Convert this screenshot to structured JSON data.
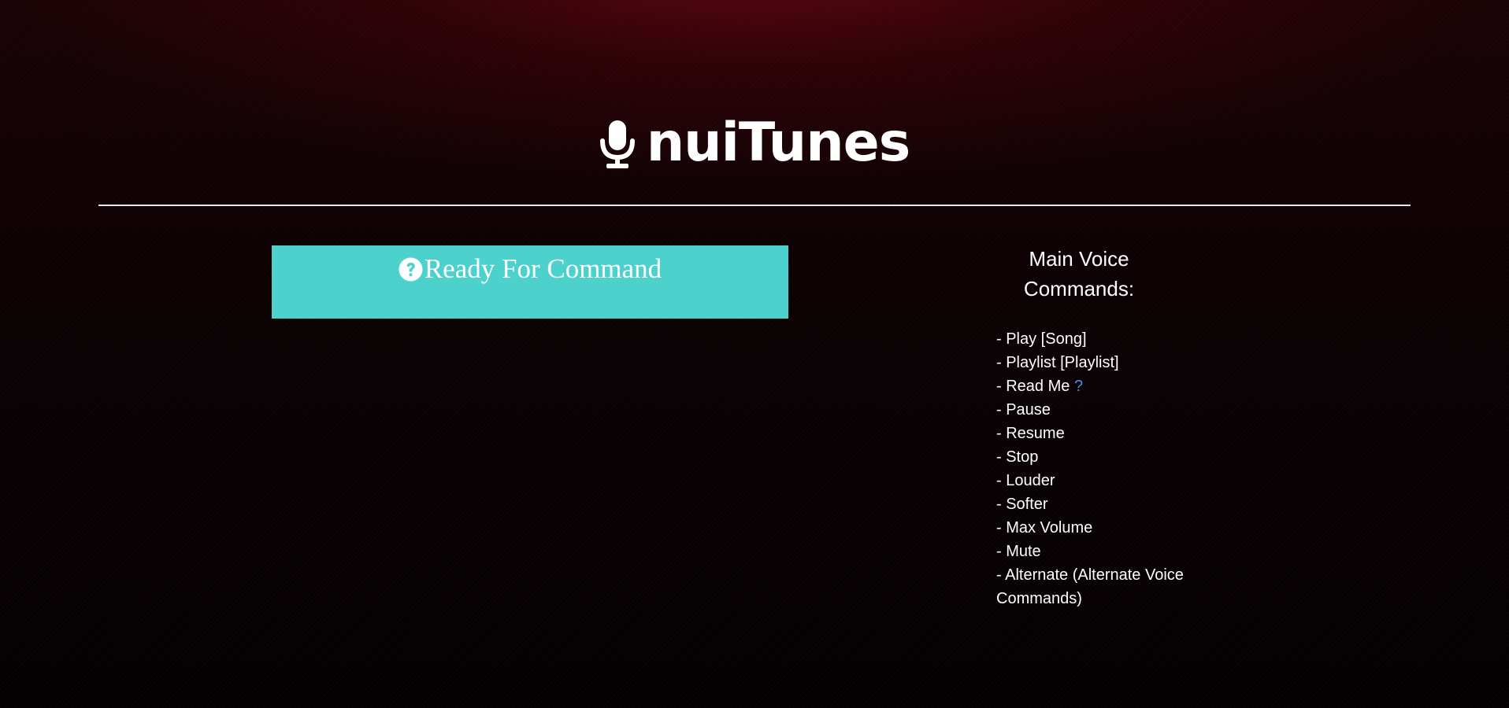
{
  "header": {
    "title": "nuiTunes",
    "logo_icon": "microphone-icon"
  },
  "status": {
    "icon": "question-circle-icon",
    "text": "Ready For Command",
    "background_color": "#4cd1cc"
  },
  "commands": {
    "title": "Main Voice Commands:",
    "items": {
      "play": "- Play [Song]",
      "playlist": "- Playlist [Playlist]",
      "read_me": "- Read Me ",
      "read_me_link": "?",
      "pause": "- Pause",
      "resume": "- Resume",
      "stop": "- Stop",
      "louder": "- Louder",
      "softer": "- Softer",
      "max_volume": "- Max Volume",
      "mute": "- Mute",
      "alternate": "- Alternate (Alternate Voice Commands)"
    },
    "link_color": "#4a8fe0"
  }
}
